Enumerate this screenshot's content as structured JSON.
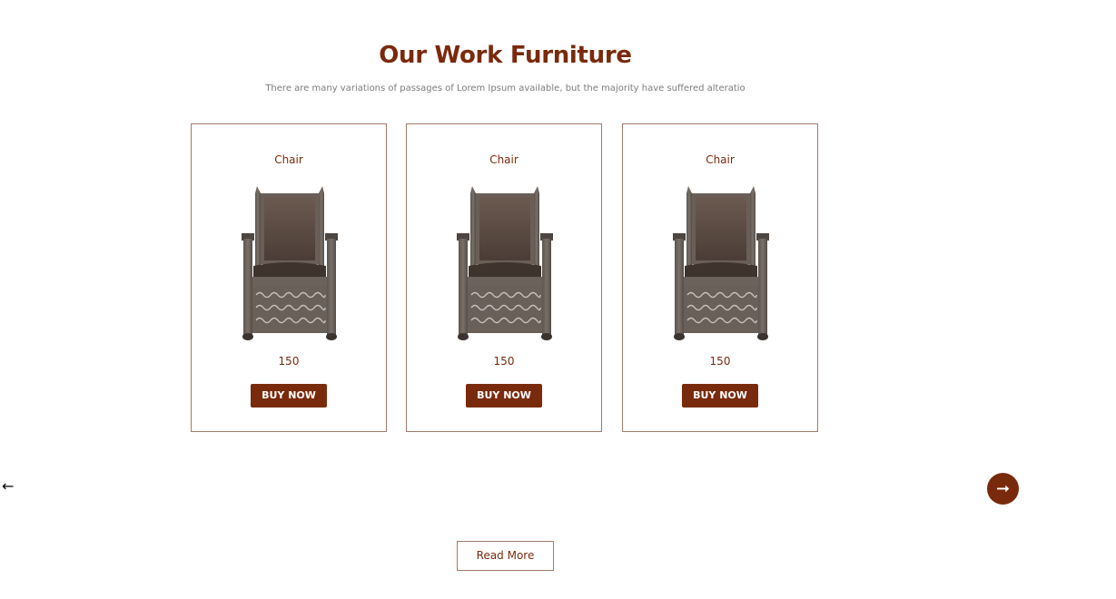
{
  "section": {
    "title": "Our Work Furniture",
    "subtitle": "There are many variations of passages of Lorem Ipsum available, but the majority have suffered alteratio"
  },
  "products": [
    {
      "name": "Chair",
      "price": "150",
      "button_label": "BUY NOW",
      "image_icon": "chair-image"
    },
    {
      "name": "Chair",
      "price": "150",
      "button_label": "BUY NOW",
      "image_icon": "chair-image"
    },
    {
      "name": "Chair",
      "price": "150",
      "button_label": "BUY NOW",
      "image_icon": "chair-image"
    }
  ],
  "carousel": {
    "prev_icon": "←",
    "next_icon": "➞"
  },
  "read_more_label": "Read More",
  "colors": {
    "brand": "#7a2a0c",
    "border": "#a47a6a",
    "subtitle_text": "#7c7c7c"
  }
}
